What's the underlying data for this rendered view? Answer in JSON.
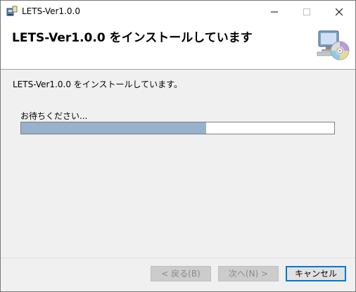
{
  "window": {
    "title": "LETS-Ver1.0.0"
  },
  "header": {
    "title": "LETS-Ver1.0.0 をインストールしています",
    "icon": "installer-disc-icon"
  },
  "main": {
    "message": "LETS-Ver1.0.0 をインストールしています。",
    "wait_label": "お待ちください...",
    "progress_fraction": 0.59,
    "progress_color": "#98b1cc"
  },
  "buttons": {
    "back_label": "< 戻る(B)",
    "next_label": "次へ(N) >",
    "cancel_label": "キャンセル"
  },
  "colors": {
    "accent": "#0078d7"
  }
}
